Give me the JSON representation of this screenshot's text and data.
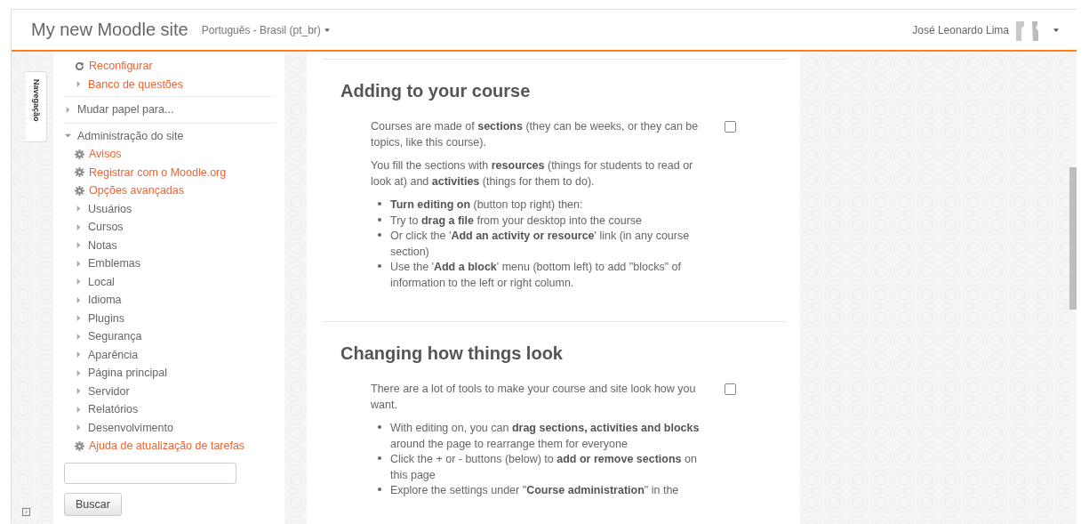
{
  "header": {
    "site_name": "My new Moodle site",
    "language": "Português - Brasil (pt_br)",
    "user_name": "José Leonardo Lima"
  },
  "dock": {
    "tab_label": "Navegação"
  },
  "sidebar": {
    "fragment": [
      {
        "label": "Reconfigurar",
        "kind": "refresh",
        "link": true
      },
      {
        "label": "Banco de questões",
        "kind": "branch",
        "link": true,
        "expanded": false
      }
    ],
    "nodes": [
      {
        "label": "Mudar papel para...",
        "kind": "branch",
        "link": false,
        "expanded": false
      },
      {
        "label": "Administração do site",
        "kind": "branch",
        "link": false,
        "expanded": true,
        "children": [
          {
            "label": "Avisos",
            "kind": "setting",
            "link": true
          },
          {
            "label": "Registrar com o Moodle.org",
            "kind": "setting",
            "link": true
          },
          {
            "label": "Opções avançadas",
            "kind": "setting",
            "link": true
          },
          {
            "label": "Usuários",
            "kind": "branch",
            "link": false,
            "expanded": false
          },
          {
            "label": "Cursos",
            "kind": "branch",
            "link": false,
            "expanded": false
          },
          {
            "label": "Notas",
            "kind": "branch",
            "link": false,
            "expanded": false
          },
          {
            "label": "Emblemas",
            "kind": "branch",
            "link": false,
            "expanded": false
          },
          {
            "label": "Local",
            "kind": "branch",
            "link": false,
            "expanded": false
          },
          {
            "label": "Idioma",
            "kind": "branch",
            "link": false,
            "expanded": false
          },
          {
            "label": "Plugins",
            "kind": "branch",
            "link": false,
            "expanded": false
          },
          {
            "label": "Segurança",
            "kind": "branch",
            "link": false,
            "expanded": false
          },
          {
            "label": "Aparência",
            "kind": "branch",
            "link": false,
            "expanded": false
          },
          {
            "label": "Página principal",
            "kind": "branch",
            "link": false,
            "expanded": false
          },
          {
            "label": "Servidor",
            "kind": "branch",
            "link": false,
            "expanded": false
          },
          {
            "label": "Relatórios",
            "kind": "branch",
            "link": false,
            "expanded": false
          },
          {
            "label": "Desenvolvimento",
            "kind": "branch",
            "link": false,
            "expanded": false
          },
          {
            "label": "Ajuda de atualização de tarefas",
            "kind": "setting",
            "link": true
          }
        ]
      }
    ],
    "search_button": "Buscar"
  },
  "sections": [
    {
      "title": "Adding to your course",
      "checked": false,
      "paragraphs": [
        "Courses are made of **sections** (they can be weeks, or they can be topics, like this course).",
        "You fill the sections with **resources** (things for students to read or look at) and **activities** (things for them to do)."
      ],
      "bullets": [
        "**Turn editing on** (button top right) then:",
        "Try to **drag a file** from your desktop into the course",
        "Or click the '**Add an activity or resource**' link (in any course section)",
        "Use the '**Add a block**' menu (bottom left) to add \"blocks\" of information to the left or right column."
      ]
    },
    {
      "title": "Changing how things look",
      "checked": false,
      "paragraphs": [
        "There are a lot of tools to make your course and site look how you want."
      ],
      "bullets": [
        "With editing on, you can **drag sections, activities and blocks** around the page to rearrange them for everyone",
        "Click the + or - buttons (below) to **add or remove sections** on this page",
        "Explore the settings under \"**Course administration**\" in the"
      ]
    }
  ]
}
